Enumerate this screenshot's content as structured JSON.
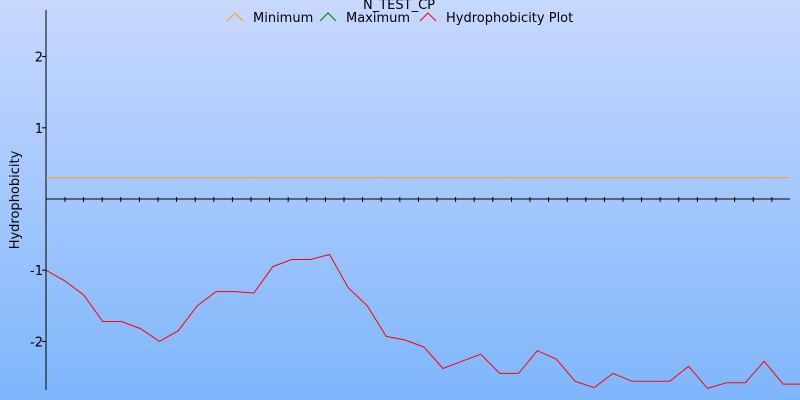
{
  "chart_data": {
    "type": "line",
    "title": "N_TEST_CP",
    "xlabel": "",
    "ylabel": "Hydrophobicity",
    "ylim": [
      -2.7,
      2.7
    ],
    "y_ticks": [
      -2,
      -1,
      1,
      2
    ],
    "y_tick_labels": [
      "-2",
      "-1",
      "1",
      "2"
    ],
    "x_tick_count": 40,
    "grid": false,
    "legend_position": "top",
    "background_colors": {
      "top": "#c8d8fe",
      "bottom": "#7eb6fc"
    },
    "series": [
      {
        "name": "Minimum",
        "color": "#ffa500",
        "x": [
          1,
          40
        ],
        "values": [
          0.3,
          0.3
        ]
      },
      {
        "name": "Maximum",
        "color": "#008000",
        "x": [],
        "values": []
      },
      {
        "name": "Hydrophobicity Plot",
        "color": "#ff0000",
        "x": [
          1,
          2,
          3,
          4,
          5,
          6,
          7,
          8,
          9,
          10,
          11,
          12,
          13,
          14,
          15,
          16,
          17,
          18,
          19,
          20,
          21,
          22,
          23,
          24,
          25,
          26,
          27,
          28,
          29,
          30,
          31,
          32,
          33,
          34,
          35,
          36,
          37,
          38,
          39,
          40,
          41
        ],
        "values": [
          -1.0,
          -1.15,
          -1.35,
          -1.72,
          -1.72,
          -1.82,
          -2.0,
          -1.85,
          -1.5,
          -1.3,
          -1.3,
          -1.32,
          -0.95,
          -0.85,
          -0.85,
          -0.78,
          -1.25,
          -1.5,
          -1.93,
          -1.98,
          -2.08,
          -2.38,
          -2.28,
          -2.18,
          -2.45,
          -2.45,
          -2.13,
          -2.25,
          -2.56,
          -2.65,
          -2.45,
          -2.56,
          -2.56,
          -2.56,
          -2.35,
          -2.66,
          -2.58,
          -2.58,
          -2.28,
          -2.6,
          -2.6
        ]
      }
    ]
  }
}
